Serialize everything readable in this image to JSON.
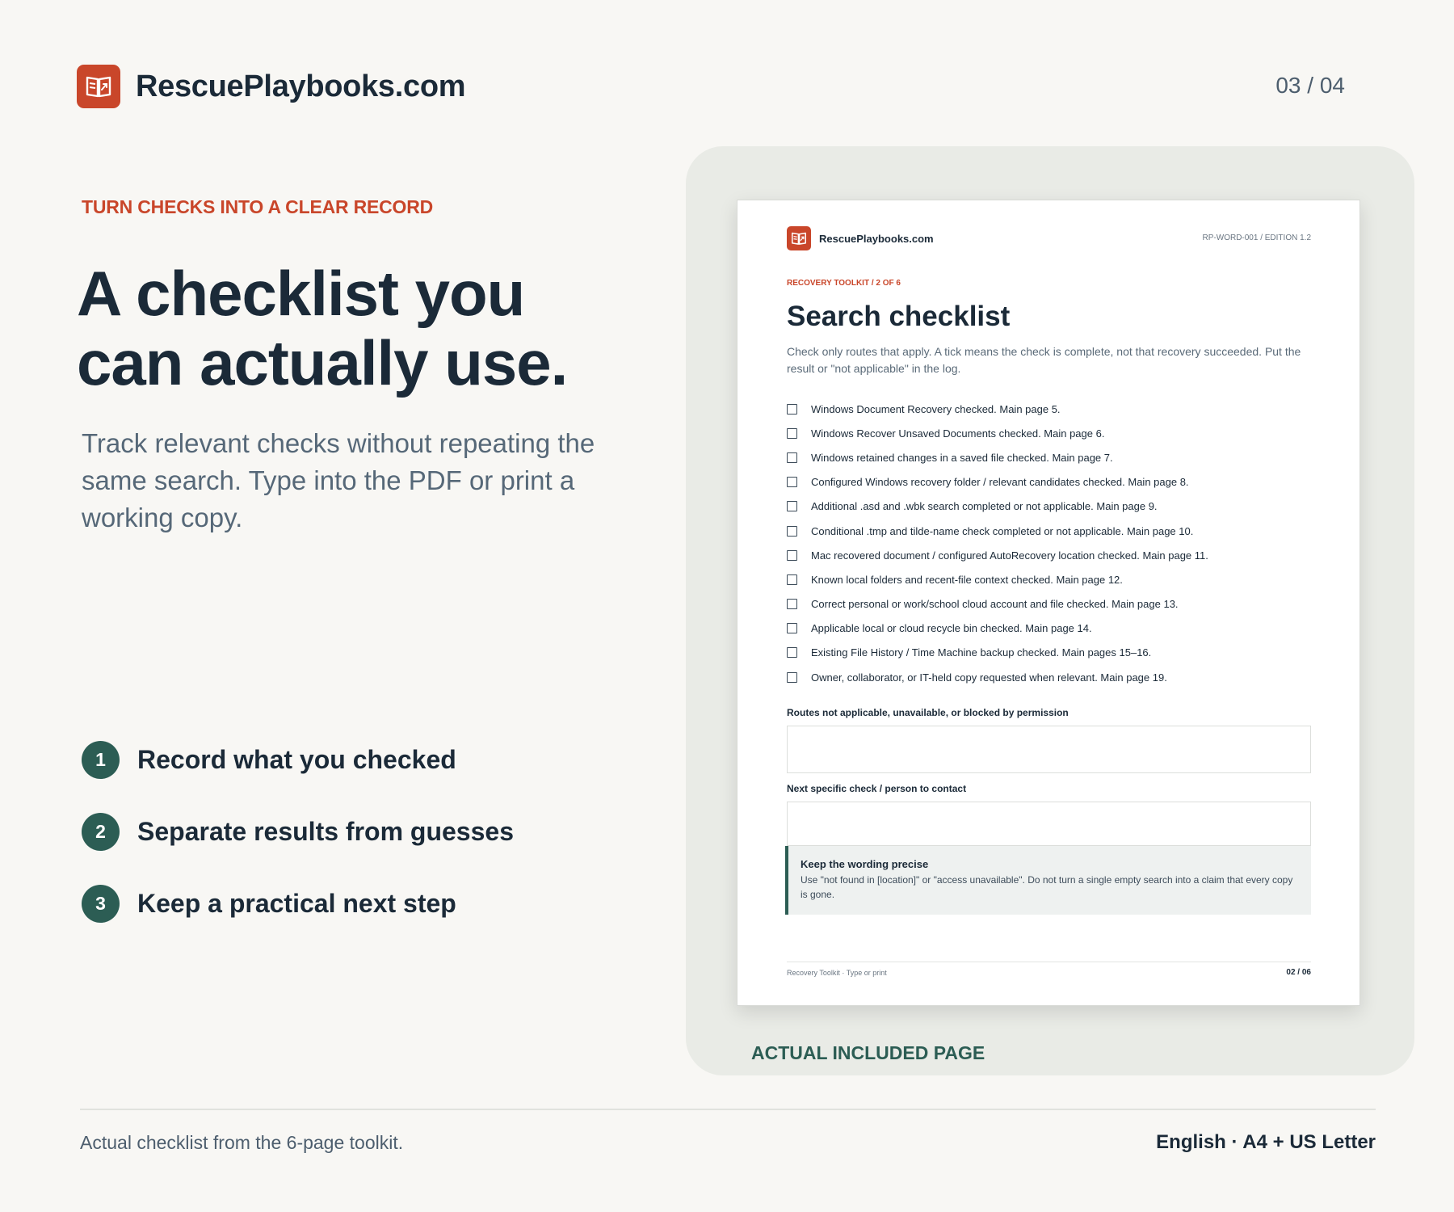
{
  "header": {
    "brand": "RescuePlaybooks.com",
    "brand_icon": "open-book-icon",
    "pager": "03 / 04"
  },
  "hero": {
    "eyebrow": "TURN CHECKS INTO A CLEAR RECORD",
    "headline": "A checklist you can actually use.",
    "subtext": "Track relevant checks without repeating the same search. Type into the PDF or print a working copy."
  },
  "steps": [
    {
      "number": "1",
      "label": "Record what you checked"
    },
    {
      "number": "2",
      "label": "Separate results from guesses"
    },
    {
      "number": "3",
      "label": "Keep a practical next step"
    }
  ],
  "preview": {
    "caption": "ACTUAL INCLUDED PAGE",
    "sheet": {
      "brand": "RescuePlaybooks.com",
      "meta": "RP-WORD-001  /  EDITION 1.2",
      "eyebrow": "RECOVERY TOOLKIT / 2 OF 6",
      "title": "Search checklist",
      "intro": "Check only routes that apply. A tick means the check is complete, not that recovery succeeded. Put the result or \"not applicable\" in the log.",
      "checks": [
        "Windows Document Recovery checked. Main page 5.",
        "Windows Recover Unsaved Documents checked. Main page 6.",
        "Windows retained changes in a saved file checked. Main page 7.",
        "Configured Windows recovery folder / relevant candidates checked. Main page 8.",
        "Additional .asd and .wbk search completed or not applicable. Main page 9.",
        "Conditional .tmp and tilde-name check completed or not applicable. Main page 10.",
        "Mac recovered document / configured AutoRecovery location checked. Main page 11.",
        "Known local folders and recent-file context checked. Main page 12.",
        "Correct personal or work/school cloud account and file checked. Main page 13.",
        "Applicable local or cloud recycle bin checked. Main page 14.",
        "Existing File History / Time Machine backup checked. Main pages 15–16.",
        "Owner, collaborator, or IT-held copy requested when relevant. Main page 19."
      ],
      "field1_label": "Routes not applicable, unavailable, or blocked by permission",
      "field2_label": "Next specific check / person to contact",
      "note_title": "Keep the wording precise",
      "note_body": "Use \"not found in [location]\" or \"access unavailable\". Do not turn a single empty search into a claim that every copy is gone.",
      "footer_left": "Recovery Toolkit · Type or print",
      "footer_right": "02 / 06"
    }
  },
  "footer": {
    "left": "Actual checklist from the 6-page toolkit.",
    "right": "English · A4 + US Letter"
  },
  "colors": {
    "accent": "#c9462a",
    "green": "#2c5d54",
    "ink": "#1b2a38",
    "background": "#f8f7f4"
  }
}
